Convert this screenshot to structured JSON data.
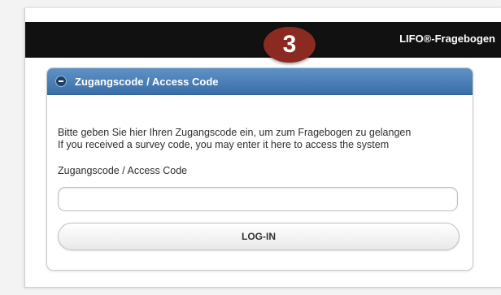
{
  "header": {
    "title": "LIFO®-Fragebogen"
  },
  "step_badge": {
    "label": "3"
  },
  "panel": {
    "title": "Zugangscode / Access Code",
    "intro_de": "Bitte geben Sie hier Ihren Zugangscode ein, um zum Fragebogen zu gelangen",
    "intro_en": "If you received a survey code, you may enter it here to access the system",
    "field_label": "Zugangscode / Access Code",
    "access_code_value": "",
    "login_label": "LOG-IN"
  },
  "colors": {
    "topbar": "#111111",
    "panel_header": "#3a6ea8",
    "badge": "#8b2a20"
  }
}
